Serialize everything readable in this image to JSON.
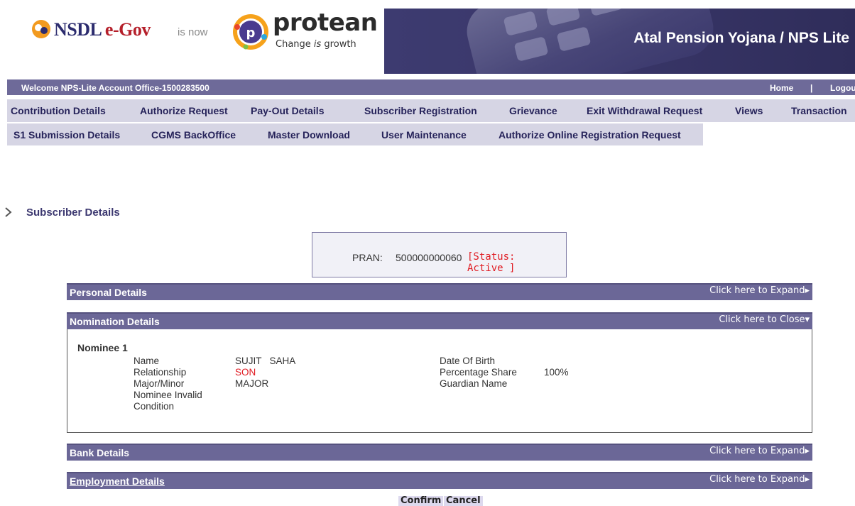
{
  "header": {
    "nsdl_brand": "NSDL",
    "egov_brand": "e-Gov",
    "is_now": "is now",
    "protean_brand": "protean",
    "protean_tagline_a": "Change ",
    "protean_tagline_b": "is",
    "protean_tagline_c": " growth",
    "banner_title": "Atal Pension Yojana / NPS Lite"
  },
  "welcome": {
    "text": "Welcome NPS-Lite Account Office-1500283500",
    "home": "Home",
    "separator": "|",
    "logout": "Logout"
  },
  "menu_row1": [
    "Contribution Details",
    "Authorize Request",
    "Pay-Out Details",
    "Subscriber Registration",
    "Grievance",
    "Exit Withdrawal Request",
    "Views",
    "Transaction"
  ],
  "menu_row2": [
    "S1 Submission Details",
    "CGMS BackOffice",
    "Master Download",
    "User Maintenance",
    "Authorize Online Registration Request"
  ],
  "section_title": "Subscriber Details",
  "pran": {
    "label": "PRAN:",
    "value": "500000000060",
    "status_line1": "[Status:",
    "status_line2": "Active ]"
  },
  "panels": {
    "personal": {
      "title": "Personal Details",
      "toggle": "Click here to Expand"
    },
    "nomination": {
      "title": "Nomination Details",
      "toggle": "Click here to Close"
    },
    "bank": {
      "title": "Bank Details",
      "toggle": "Click here to Expand"
    },
    "employment": {
      "title": "Employment Details",
      "toggle": "Click here to Expand"
    }
  },
  "nominee": {
    "heading": "Nominee 1",
    "name_label": "Name",
    "name_value": "SUJIT   SAHA",
    "relationship_label": "Relationship",
    "relationship_value": "SON",
    "major_minor_label": "Major/Minor",
    "major_minor_value": "MAJOR",
    "invalid_label_1": "Nominee Invalid",
    "invalid_label_2": "Condition",
    "dob_label": "Date Of Birth",
    "dob_value": "",
    "share_label": "Percentage Share",
    "share_value": "100%",
    "guardian_label": "Guardian Name",
    "guardian_value": ""
  },
  "buttons": {
    "confirm": "Confirm",
    "cancel": "Cancel"
  },
  "colors": {
    "bar": "#6e6a99",
    "menu_bg": "#d6d5e4",
    "banner": "#3d3b70",
    "status_red": "#e01b22"
  }
}
